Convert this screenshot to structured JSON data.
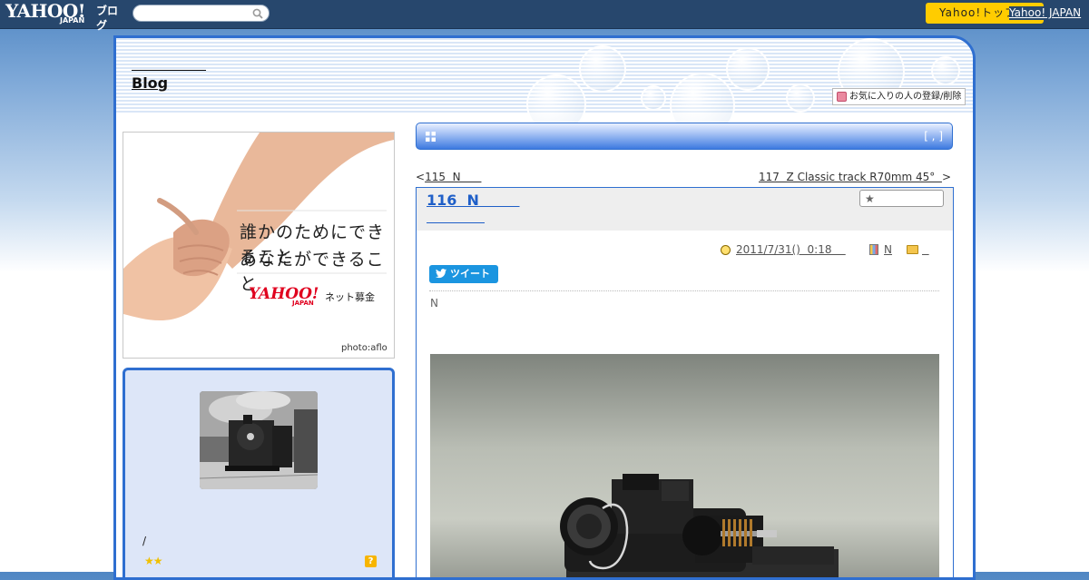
{
  "masthead": {
    "logo_text": "YAHOO!",
    "logo_sub": "JAPAN",
    "service_name": "ブログ",
    "search_placeholder": "",
    "top_button_label": "Yahoo!トップ",
    "japan_link": "Yahoo! JAPAN"
  },
  "blog": {
    "title": "Blog",
    "favorite_button": "お気に入りの人の登録/削除"
  },
  "ad": {
    "line1": "誰かのためにできること",
    "line2": "あなたができること",
    "brand": "YAHOO!",
    "brand_sub": "JAPAN",
    "service": "ネット募金",
    "credit": "photo:aflo"
  },
  "profile": {
    "slash_text": "/",
    "stars": "★★",
    "help_icon": "?"
  },
  "section_bar": {
    "brackets": "[ , ]"
  },
  "navigation": {
    "prev_marker": "<",
    "prev_link": "115  N      ",
    "next_link": "117  Z Classic track R70mm 45°  ",
    "next_marker": ">"
  },
  "article": {
    "title": "116  N        ",
    "date": "2011/7/31()  0:18    ",
    "category": "N",
    "folder": "  ",
    "tweet_label": "ツイート",
    "body_text": "N"
  },
  "colors": {
    "masthead": "#27476d",
    "frame_blue": "#2f6fd0",
    "title_link": "#1f5fc8",
    "tweet": "#1b95e0",
    "yahoo_yellow": "#ffcc00",
    "profile_bg": "#dde6f8"
  },
  "icons": [
    "search-icon",
    "favorite-icon",
    "grid-icon",
    "star-icon",
    "clock-icon",
    "category-icon",
    "folder-icon",
    "twitter-bird-icon",
    "help-icon"
  ]
}
